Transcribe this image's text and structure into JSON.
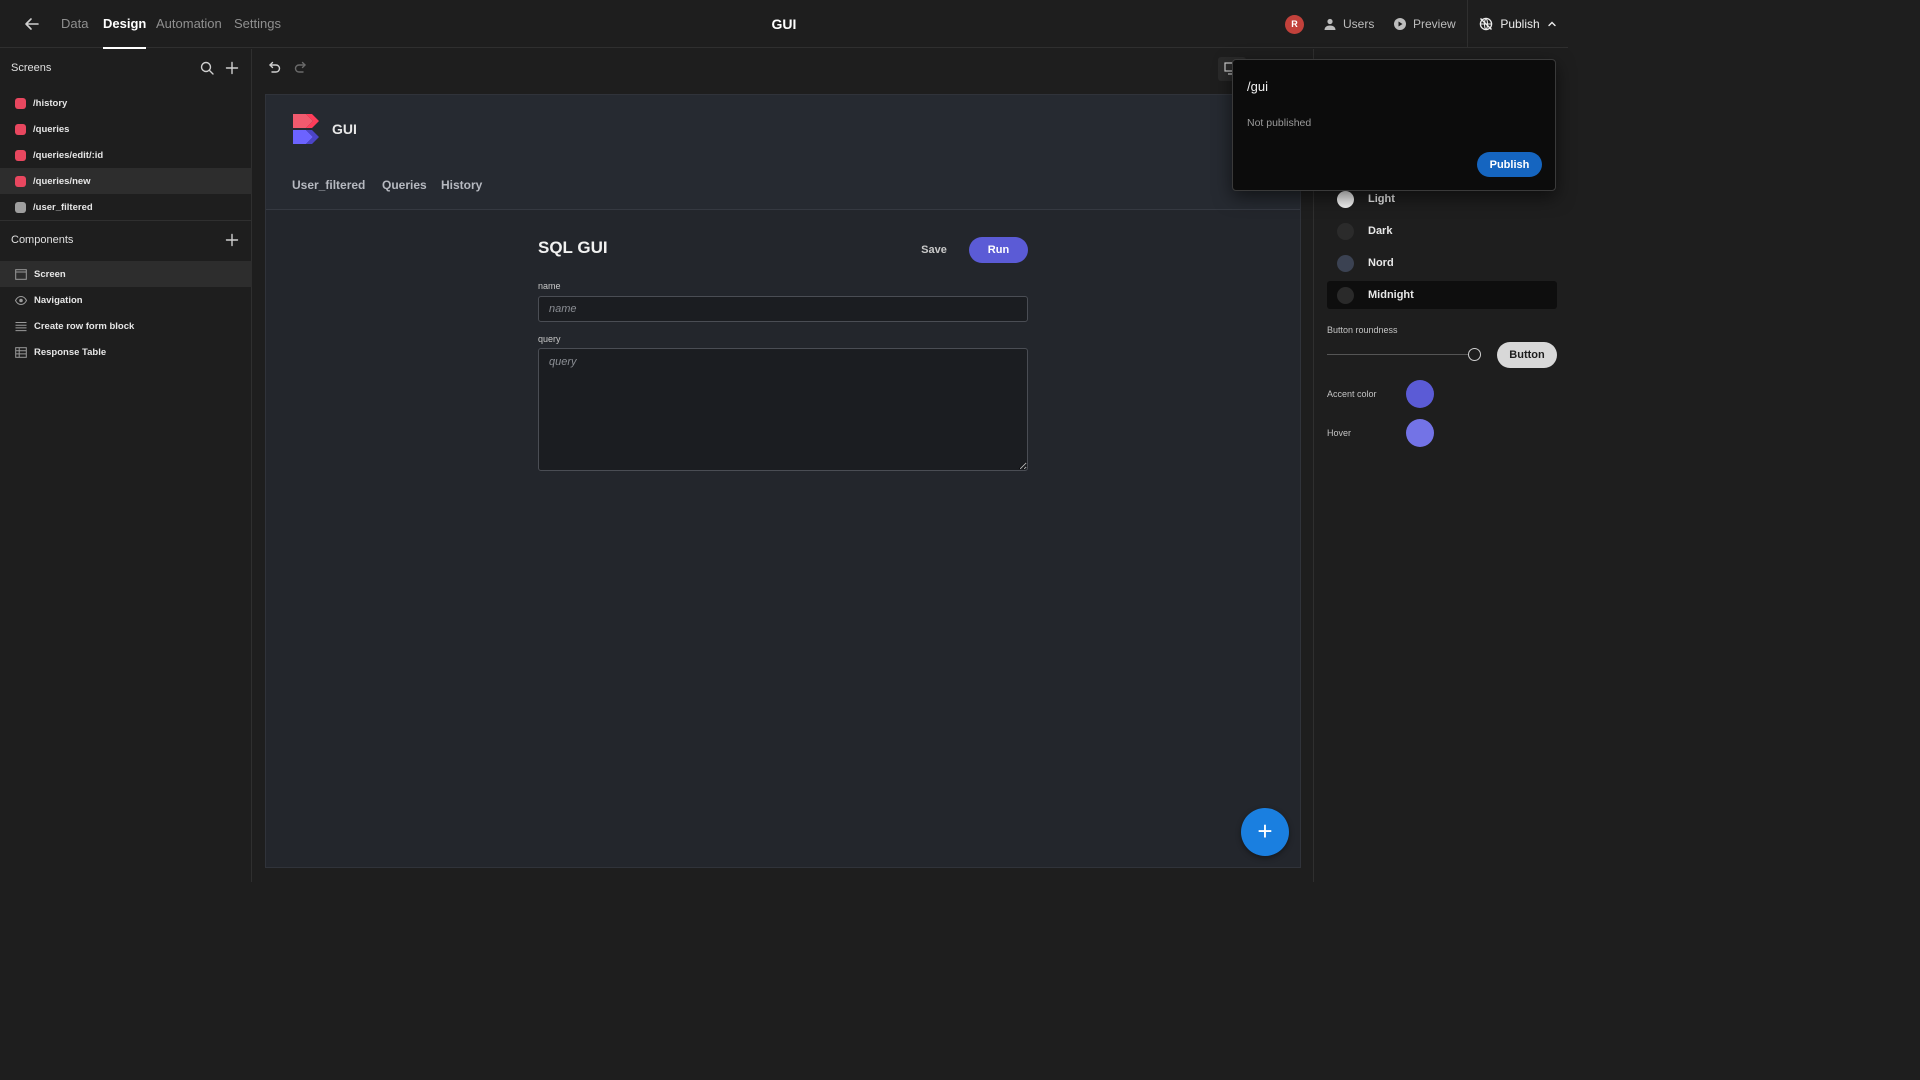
{
  "topbar": {
    "tabs": [
      {
        "label": "Data",
        "active": false
      },
      {
        "label": "Design",
        "active": true
      },
      {
        "label": "Automation",
        "active": false
      },
      {
        "label": "Settings",
        "active": false
      }
    ],
    "app_title": "GUI",
    "avatar_initial": "R",
    "users_label": "Users",
    "preview_label": "Preview",
    "publish_label": "Publish"
  },
  "sidebar": {
    "screens_title": "Screens",
    "screens": [
      {
        "label": "/history",
        "color": "#e8475f"
      },
      {
        "label": "/queries",
        "color": "#e8475f"
      },
      {
        "label": "/queries/edit/:id",
        "color": "#e8475f"
      },
      {
        "label": "/queries/new",
        "color": "#e8475f"
      },
      {
        "label": "/user_filtered",
        "color": "#9e9e9e"
      }
    ],
    "components_title": "Components",
    "components": [
      {
        "label": "Screen",
        "icon": "screen-icon"
      },
      {
        "label": "Navigation",
        "icon": "eye-icon"
      },
      {
        "label": "Create row form block",
        "icon": "form-icon"
      },
      {
        "label": "Response Table",
        "icon": "table-icon"
      }
    ]
  },
  "preview": {
    "app_name": "GUI",
    "nav_links": [
      "User_filtered",
      "Queries",
      "History"
    ],
    "form_title": "SQL GUI",
    "save_label": "Save",
    "run_label": "Run",
    "fields": {
      "name_label": "name",
      "name_placeholder": "name",
      "query_label": "query",
      "query_placeholder": "query"
    },
    "fab_symbol": "+"
  },
  "right_panel": {
    "themes": [
      {
        "label": "Light",
        "color": "#f2f2f2",
        "selected": false
      },
      {
        "label": "Dark",
        "color": "#2b2b2b",
        "selected": false
      },
      {
        "label": "Nord",
        "color": "#3b4252",
        "selected": false
      },
      {
        "label": "Midnight",
        "color": "#2a2a2a",
        "selected": true
      }
    ],
    "button_roundness_label": "Button roundness",
    "button_demo_label": "Button",
    "accent_color_label": "Accent color",
    "accent_color": "#5b5bd6",
    "hover_label": "Hover",
    "hover_color": "#7373e6"
  },
  "popover": {
    "url": "/gui",
    "status": "Not published",
    "publish_label": "Publish"
  }
}
